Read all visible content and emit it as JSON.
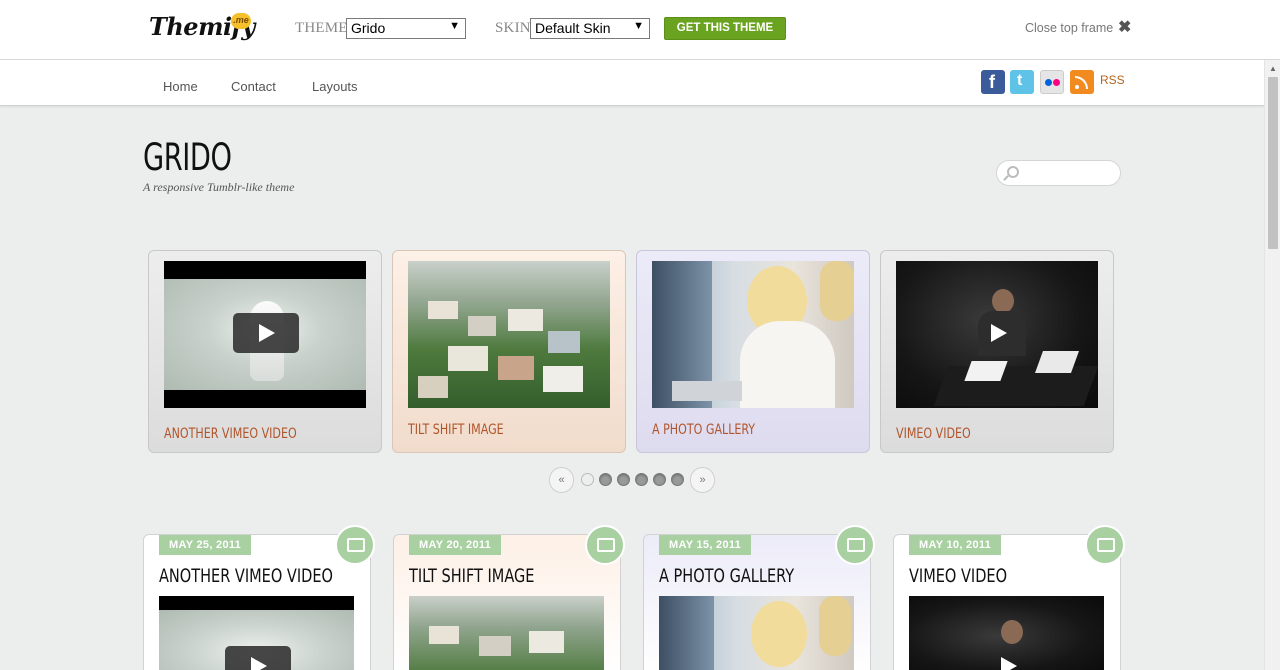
{
  "topframe": {
    "logo_text": "Themify",
    "logo_badge": ".me",
    "theme_label": "THEME",
    "theme_value": "Grido",
    "skin_label": "SKIN",
    "skin_value": "Default Skin",
    "get_theme_button": "GET THIS THEME",
    "close_label": "Close top frame",
    "close_icon": "✖"
  },
  "nav": {
    "items": [
      "Home",
      "Contact",
      "Layouts"
    ],
    "social": [
      "facebook-icon",
      "twitter-icon",
      "flickr-icon",
      "rss-icon"
    ],
    "rss_label": "RSS"
  },
  "header": {
    "title": "GRIDO",
    "tagline": "A responsive Tumblr-like theme",
    "search_placeholder": ""
  },
  "slider": {
    "slides": [
      {
        "caption": "ANOTHER VIMEO VIDEO",
        "type": "video"
      },
      {
        "caption": "TILT SHIFT IMAGE",
        "type": "image"
      },
      {
        "caption": "A PHOTO GALLERY",
        "type": "gallery"
      },
      {
        "caption": "VIMEO VIDEO",
        "type": "video"
      }
    ],
    "prev": "«",
    "next": "»",
    "pages": 6,
    "active_page": 1
  },
  "posts": [
    {
      "date": "MAY 25, 2011",
      "title": "ANOTHER VIMEO VIDEO",
      "type_icon": "video-clapper-icon"
    },
    {
      "date": "MAY 20, 2011",
      "title": "TILT SHIFT IMAGE",
      "type_icon": "image-icon"
    },
    {
      "date": "MAY 15, 2011",
      "title": "A PHOTO GALLERY",
      "type_icon": "gallery-icon"
    },
    {
      "date": "MAY 10, 2011",
      "title": "VIMEO VIDEO",
      "type_icon": "video-clapper-icon"
    }
  ],
  "colors": {
    "accent_green": "#6aa31f",
    "badge_green": "#a8d0a1",
    "caption_orange": "#b0552b",
    "card_orange": "#fbe9dc",
    "card_purple": "#e8e6f7",
    "card_grey": "#eaeaea"
  }
}
